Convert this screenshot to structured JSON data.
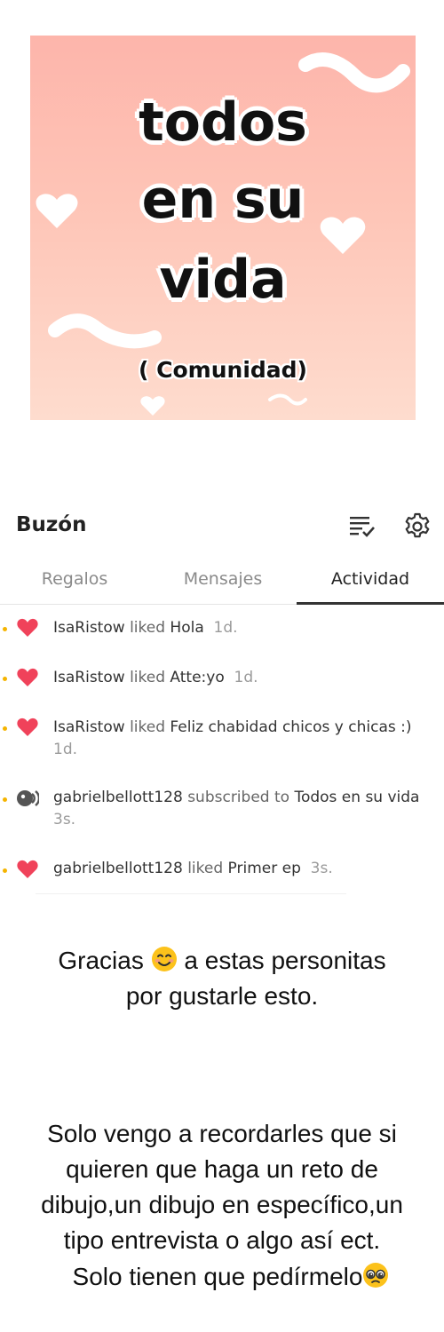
{
  "cover": {
    "title_lines": [
      "todos",
      "en su",
      "vida"
    ],
    "subtitle": "( Comunidad)"
  },
  "header": {
    "title": "Buzón",
    "icons": [
      "mark-read-icon",
      "gear-icon"
    ]
  },
  "tabs": [
    {
      "label": "Regalos",
      "active": false
    },
    {
      "label": "Mensajes",
      "active": false
    },
    {
      "label": "Actividad",
      "active": true
    }
  ],
  "activity": [
    {
      "icon": "heart-icon",
      "user": "IsaRistow",
      "action": "liked",
      "target": "Hola",
      "time": "1d."
    },
    {
      "icon": "heart-icon",
      "user": "IsaRistow",
      "action": "liked",
      "target": "Atte:yo",
      "time": "1d."
    },
    {
      "icon": "heart-icon",
      "user": "IsaRistow",
      "action": "liked",
      "target": "Feliz chabidad chicos y chicas :)",
      "time": "1d."
    },
    {
      "icon": "subscribe-icon",
      "user": "gabrielbellott128",
      "action": "subscribed to",
      "target": "Todos en su vida",
      "time": "3s."
    },
    {
      "icon": "heart-icon",
      "user": "gabrielbellott128",
      "action": "liked",
      "target": "Primer ep",
      "time": "3s."
    }
  ],
  "messages": {
    "thanks_line1": "Gracias",
    "thanks_line1_rest": "a estas personitas",
    "thanks_line2": "por gustarle esto.",
    "reminder_lines": [
      "Solo vengo a recordarles que si",
      "quieren que haga un reto de",
      "dibujo,un dibujo en específico,un",
      "tipo entrevista o algo así ect."
    ],
    "reminder_last": "Solo tienen que pedírmelo"
  },
  "colors": {
    "heart": "#f0425a",
    "dot": "#f5b400",
    "cover_top": "#fdb5ab",
    "cover_bottom": "#fedcce"
  }
}
